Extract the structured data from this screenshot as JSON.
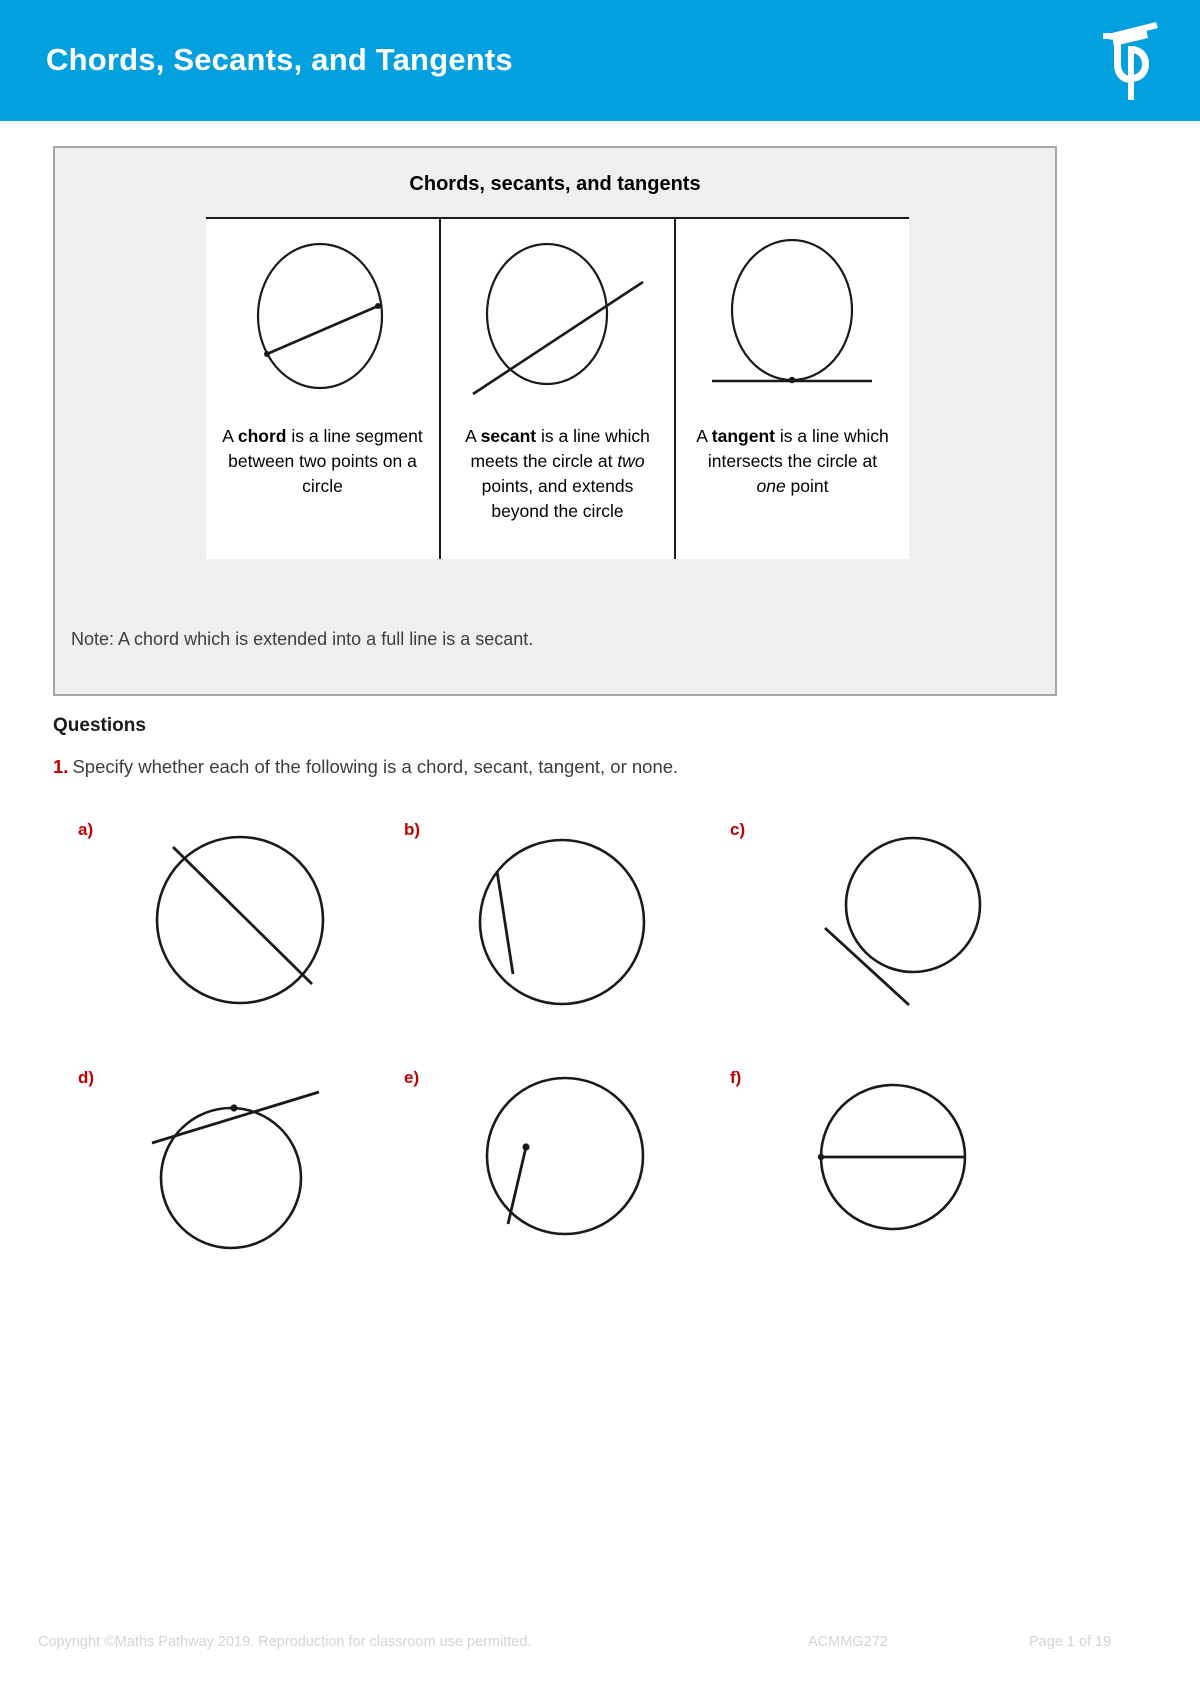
{
  "header": {
    "title": "Chords, Secants, and Tangents",
    "logo_name": "maths-pathway-logo",
    "background_color": "#03a0e0"
  },
  "info_box": {
    "title": "Chords, secants, and tangents",
    "note": "Note: A chord which is extended into a full line is a secant.",
    "background_color": "#efefef",
    "border_color": "#a6a6a6",
    "definitions": [
      {
        "figure": "circle-with-chord",
        "text_parts": [
          {
            "text": "A ",
            "style": "normal"
          },
          {
            "text": "chord",
            "style": "bold"
          },
          {
            "text": " is a line segment between two points on a circle",
            "style": "normal"
          }
        ],
        "plain": "A chord is a line segment between two points on a circle"
      },
      {
        "figure": "circle-with-secant",
        "text_parts": [
          {
            "text": "A ",
            "style": "normal"
          },
          {
            "text": "secant",
            "style": "bold"
          },
          {
            "text": " is a line which meets the circle at ",
            "style": "normal"
          },
          {
            "text": "two",
            "style": "italic"
          },
          {
            "text": " points, and extends beyond the circle",
            "style": "normal"
          }
        ],
        "plain": "A secant is a line which meets the circle at two points, and extends beyond the circle"
      },
      {
        "figure": "circle-with-tangent",
        "text_parts": [
          {
            "text": "A ",
            "style": "normal"
          },
          {
            "text": "tangent",
            "style": "bold"
          },
          {
            "text": " is a line which intersects the circle at ",
            "style": "normal"
          },
          {
            "text": "one",
            "style": "italic"
          },
          {
            "text": " point",
            "style": "normal"
          }
        ],
        "plain": "A tangent is a line which intersects the circle at one point"
      }
    ]
  },
  "questions": {
    "heading": "Questions",
    "items": [
      {
        "number": "1.",
        "number_color": "#c00000",
        "text": "Specify whether each of the following is a chord, secant, tangent, or none.",
        "parts": [
          {
            "label": "a)",
            "figure": "secant-through-circle"
          },
          {
            "label": "b)",
            "figure": "chord-near-left-edge"
          },
          {
            "label": "c)",
            "figure": "line-outside-circle"
          },
          {
            "label": "d)",
            "figure": "tangent-touching-top"
          },
          {
            "label": "e)",
            "figure": "segment-from-interior-point"
          },
          {
            "label": "f)",
            "figure": "horizontal-diameter-chord"
          }
        ]
      }
    ]
  },
  "footer": {
    "copyright": "Copyright ©Maths Pathway 2019. Reproduction for classroom use permitted.",
    "curriculum_code": "ACMMG272",
    "page_label": "Page 1 of 19"
  }
}
